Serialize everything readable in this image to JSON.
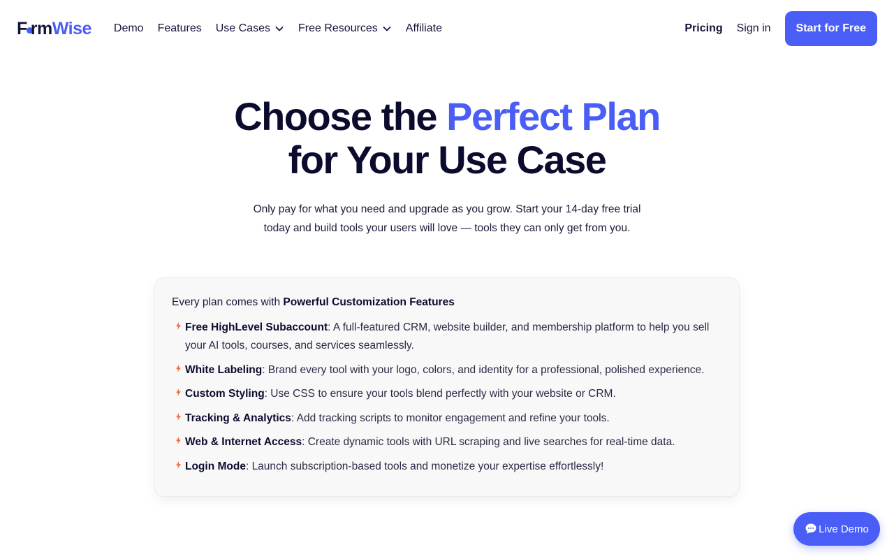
{
  "brand": {
    "part1": "F",
    "part2": "rm",
    "part3": "Wise"
  },
  "nav": {
    "items": [
      {
        "label": "Demo"
      },
      {
        "label": "Features"
      },
      {
        "label": "Use Cases"
      },
      {
        "label": "Free Resources"
      },
      {
        "label": "Affiliate"
      }
    ],
    "pricing": "Pricing",
    "signin": "Sign in",
    "cta": "Start for Free"
  },
  "hero": {
    "line1_a": "Choose the ",
    "line1_accent": "Perfect Plan",
    "line2": "for Your Use Case",
    "sub_line1": "Only pay for what you need and upgrade as you grow. Start your 14-day free trial",
    "sub_line2": "today and build tools your users will love — tools they can only get from you."
  },
  "card": {
    "intro": "Every plan comes with ",
    "intro_bold": "Powerful Customization Features",
    "features": [
      {
        "title": "Free HighLevel Subaccount",
        "desc": ": A full-featured CRM, website builder, and membership platform to help you sell your AI tools, courses, and services seamlessly."
      },
      {
        "title": "White Labeling",
        "desc": ": Brand every tool with your logo, colors, and identity for a professional, polished experience."
      },
      {
        "title": "Custom Styling",
        "desc": ": Use CSS to ensure your tools blend perfectly with your website or CRM."
      },
      {
        "title": "Tracking & Analytics",
        "desc": ": Add tracking scripts to monitor engagement and refine your tools."
      },
      {
        "title": "Web & Internet Access",
        "desc": ": Create dynamic tools with URL scraping and live searches for real-time data."
      },
      {
        "title": "Login Mode",
        "desc": ": Launch subscription-based tools and monetize your expertise effortlessly!"
      }
    ]
  },
  "live_demo": {
    "label": "Live Demo"
  },
  "colors": {
    "accent": "#4a5ef7",
    "bolt": "#f26b3a",
    "ink": "#0b0b2e"
  }
}
